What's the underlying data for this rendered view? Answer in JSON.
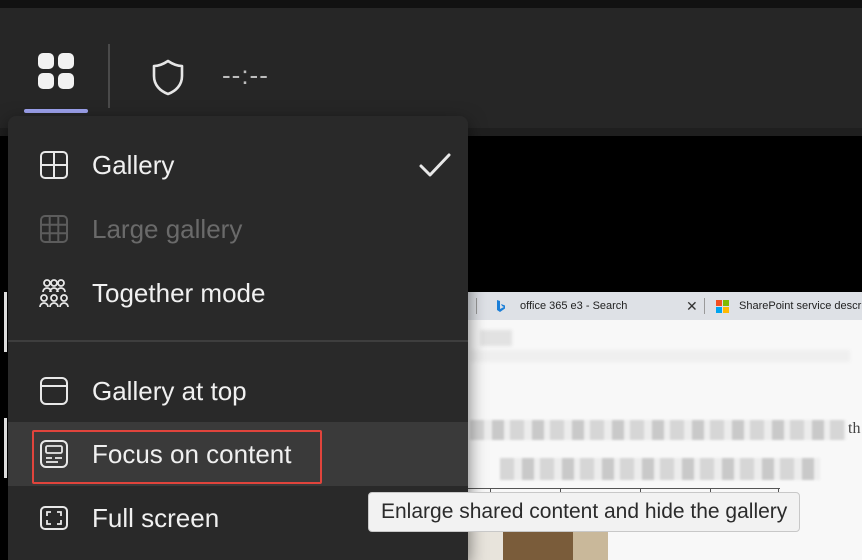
{
  "toolbar": {
    "timer": "--:--",
    "active_indicator_color": "#9ea3f0"
  },
  "menu": {
    "items": [
      {
        "label": "Gallery",
        "icon": "gallery-grid-icon",
        "checked": true,
        "disabled": false
      },
      {
        "label": "Large gallery",
        "icon": "large-gallery-icon",
        "checked": false,
        "disabled": true
      },
      {
        "label": "Together mode",
        "icon": "together-mode-icon",
        "checked": false,
        "disabled": false
      },
      {
        "label": "Gallery at top",
        "icon": "gallery-at-top-icon",
        "checked": false,
        "disabled": false
      },
      {
        "label": "Focus on content",
        "icon": "focus-on-content-icon",
        "checked": false,
        "disabled": false,
        "hovered": true
      },
      {
        "label": "Full screen",
        "icon": "full-screen-icon",
        "checked": false,
        "disabled": false
      }
    ],
    "highlight_color": "#e0443c"
  },
  "tooltip": {
    "text": "Enlarge shared content and hide the gallery"
  },
  "shared_screen": {
    "tabs": [
      {
        "label": "office 365 e3 - Search",
        "icon": "bing-icon"
      },
      {
        "label": "SharePoint service descri",
        "icon": "microsoft-logo-icon"
      }
    ],
    "close_glyph": "✕",
    "edge_text": "th"
  }
}
